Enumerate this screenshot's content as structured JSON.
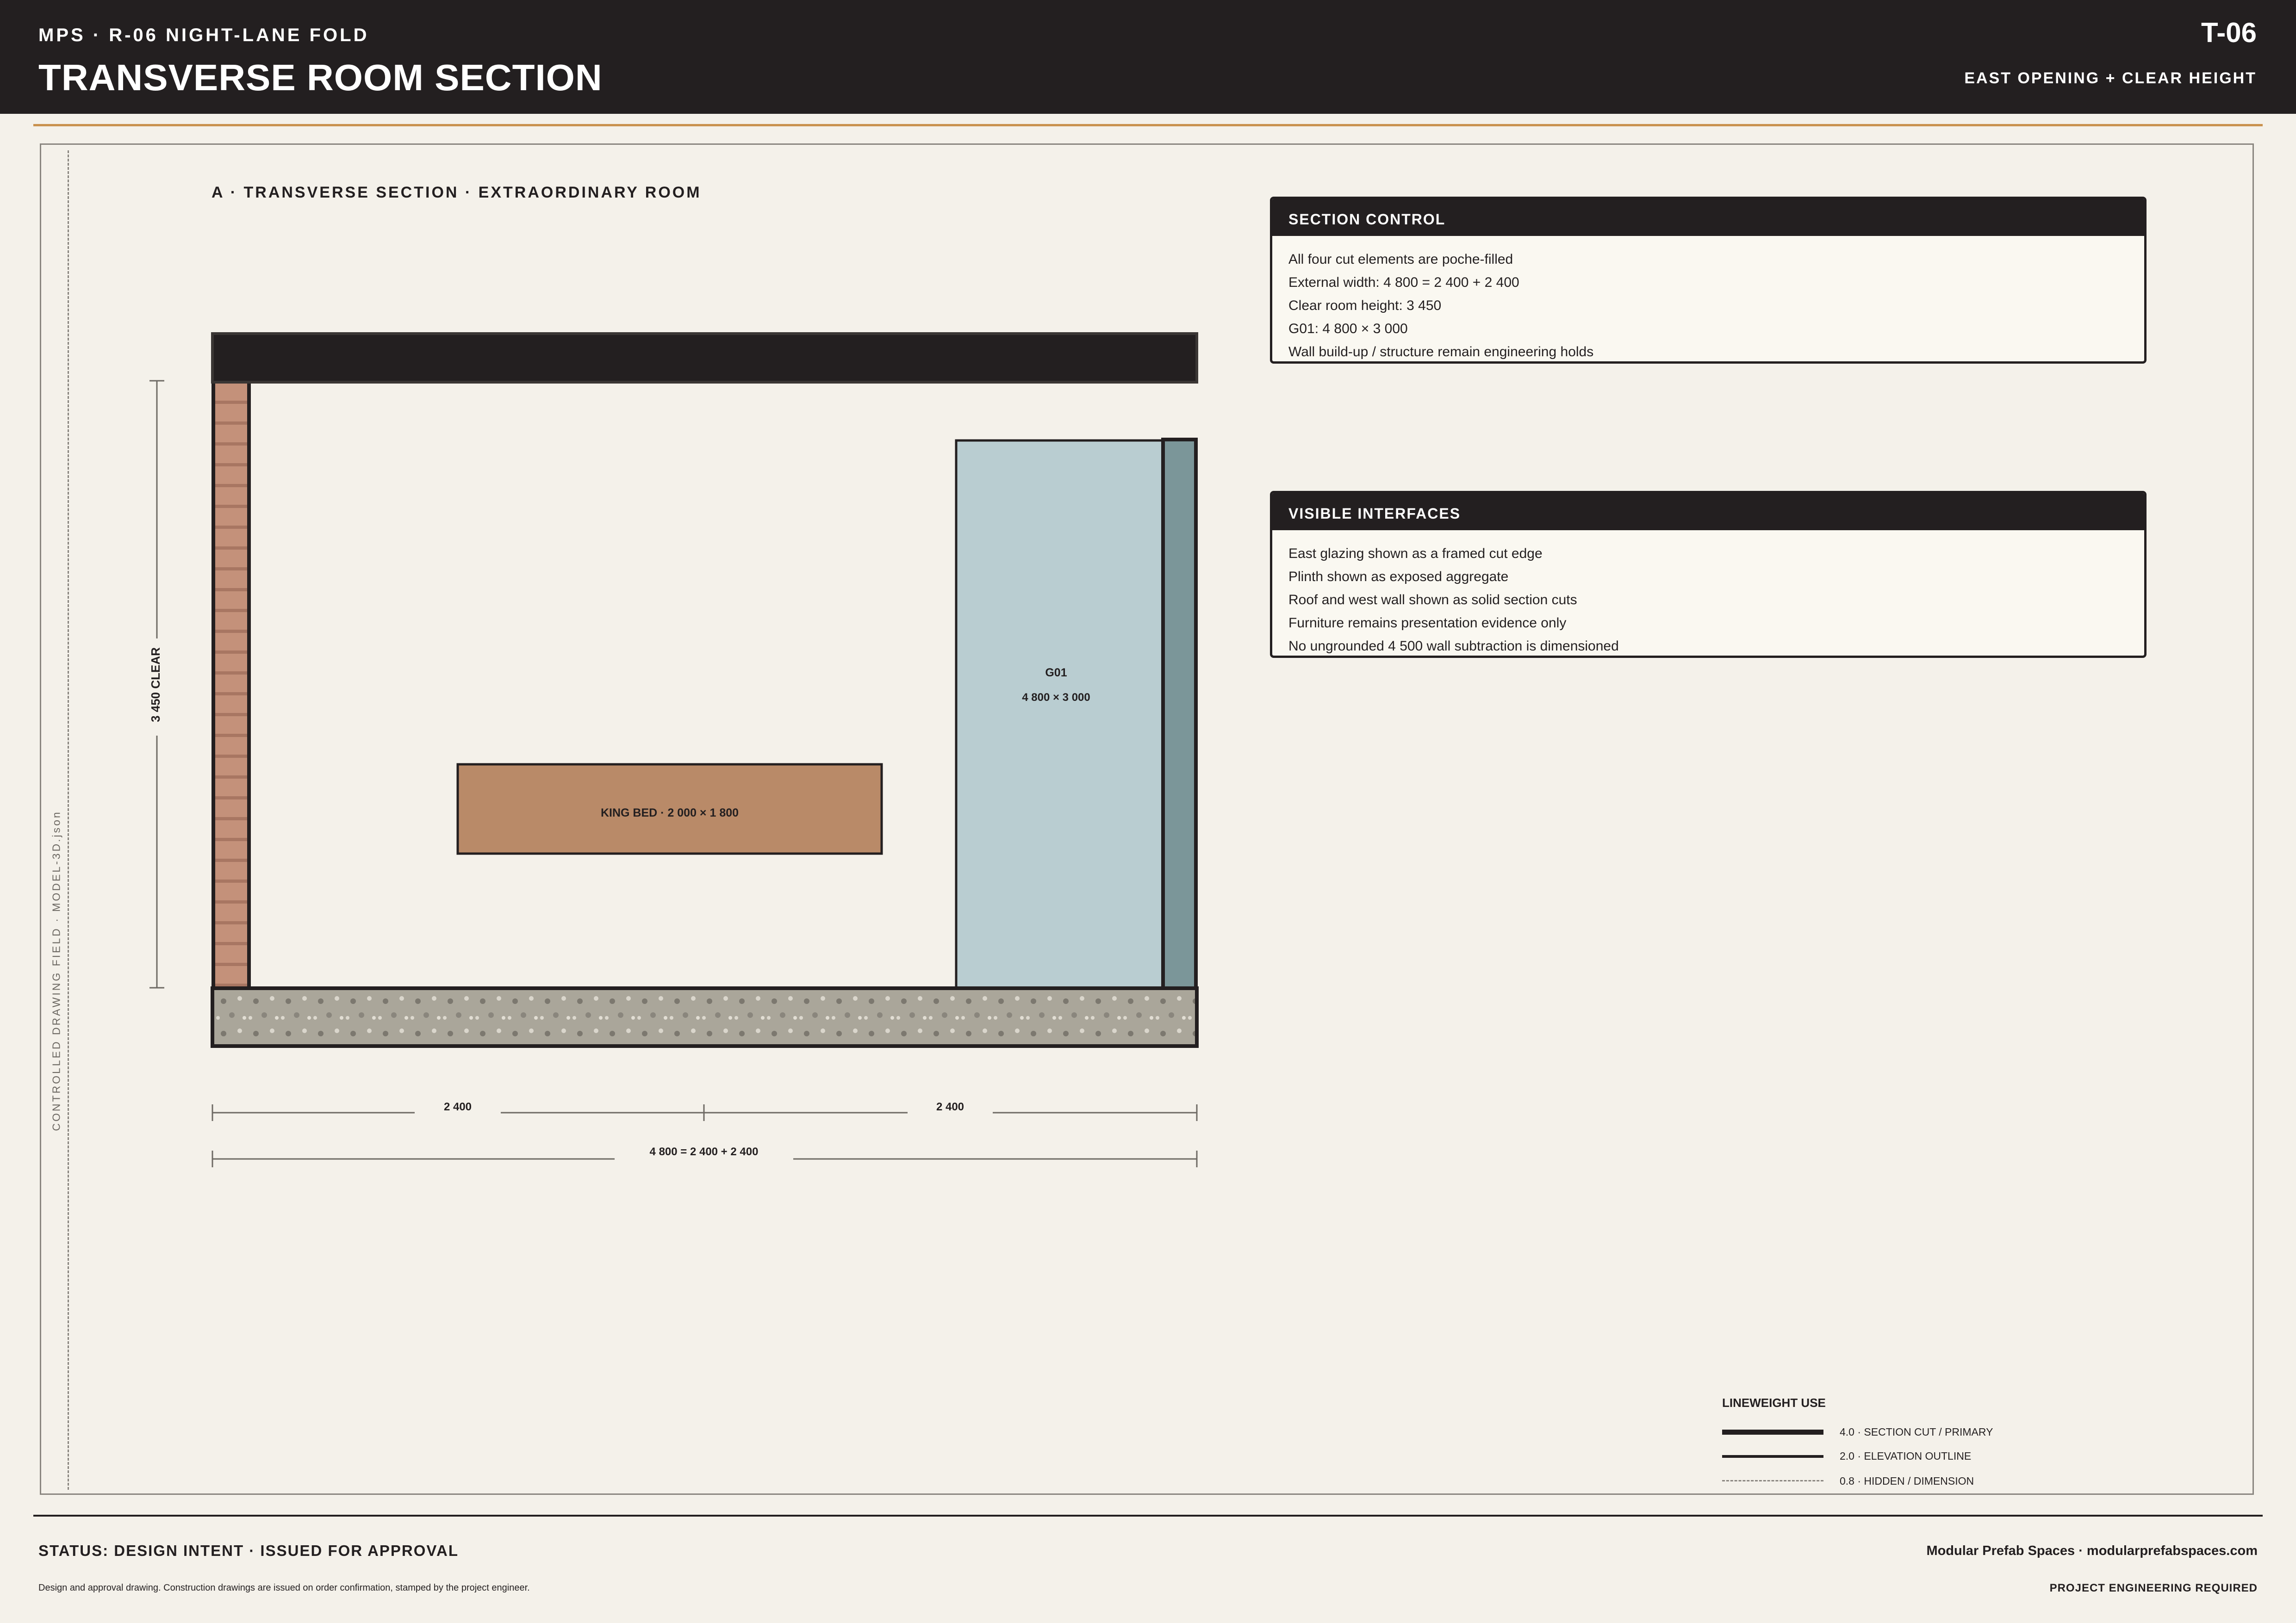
{
  "header": {
    "project": "MPS · R-06 NIGHT-LANE FOLD",
    "title": "TRANSVERSE ROOM SECTION",
    "sheet_no": "T-06",
    "subtitle": "EAST OPENING + CLEAR HEIGHT"
  },
  "drawing": {
    "side_label": "CONTROLLED DRAWING FIELD · MODEL-3D.json",
    "view_title": "A · TRANSVERSE SECTION · EXTRAORDINARY ROOM",
    "clear_height_label": "3 450 CLEAR",
    "bed_label": "KING BED · 2 000 × 1 800",
    "glazing_id": "G01",
    "glazing_size": "4 800 × 3 000",
    "dim_left": "2 400",
    "dim_right": "2 400",
    "dim_total": "4 800 = 2 400 + 2 400"
  },
  "section_control": {
    "heading": "SECTION CONTROL",
    "lines": [
      "All four cut elements are poche-filled",
      "External width: 4 800 = 2 400 + 2 400",
      "Clear room height: 3 450",
      "G01: 4 800 × 3 000",
      "Wall build-up / structure remain engineering holds"
    ]
  },
  "visible_interfaces": {
    "heading": "VISIBLE INTERFACES",
    "lines": [
      "East glazing shown as a framed cut edge",
      "Plinth shown as exposed aggregate",
      "Roof and west wall shown as solid section cuts",
      "Furniture remains presentation evidence only",
      "No ungrounded 4 500 wall subtraction is dimensioned"
    ]
  },
  "legend": {
    "title": "LINEWEIGHT USE",
    "items": [
      "4.0 · SECTION CUT / PRIMARY",
      "2.0 · ELEVATION OUTLINE",
      "0.8 · HIDDEN / DIMENSION"
    ]
  },
  "footer": {
    "status": "STATUS: DESIGN INTENT · ISSUED FOR APPROVAL",
    "disclaimer": "Design and approval drawing. Construction drawings are issued on order confirmation, stamped by the project engineer.",
    "company": "Modular Prefab Spaces · modularprefabspaces.com",
    "engineering": "PROJECT ENGINEERING REQUIRED"
  },
  "colors": {
    "ink": "#231f20",
    "paper": "#f4f1ea",
    "accent": "#c9924f",
    "brick": "#c4917a",
    "bed": "#b98a68",
    "glass": "#b9cdd1",
    "glass_frame": "#7b9699",
    "aggregate": "#aaa69a"
  }
}
